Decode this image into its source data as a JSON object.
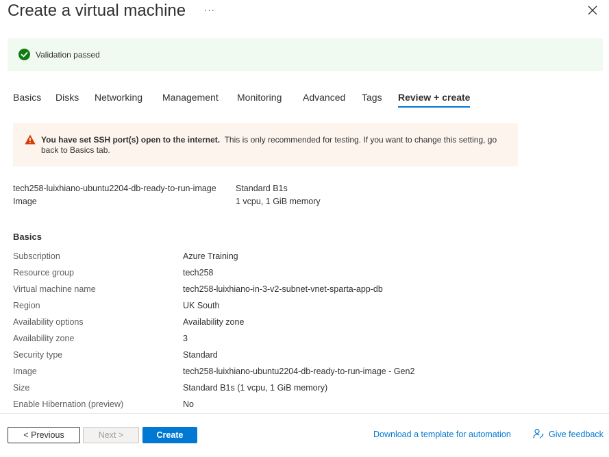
{
  "header": {
    "title": "Create a virtual machine",
    "more": "···"
  },
  "validation": {
    "text": "Validation passed",
    "color": "#107c10"
  },
  "tabs": [
    {
      "label": "Basics"
    },
    {
      "label": "Disks"
    },
    {
      "label": "Networking"
    },
    {
      "label": "Management"
    },
    {
      "label": "Monitoring"
    },
    {
      "label": "Advanced"
    },
    {
      "label": "Tags"
    },
    {
      "label": "Review + create",
      "active": true
    }
  ],
  "warning": {
    "bold": "You have set SSH port(s) open to the internet.",
    "text": "This is only recommended for testing.  If you want to change this setting, go back to Basics tab.",
    "color": "#d83b01"
  },
  "summary": {
    "image_name": "tech258-luixhiano-ubuntu2204-db-ready-to-run-image",
    "image_label": "Image",
    "size_name": "Standard B1s",
    "size_detail": "1 vcpu, 1 GiB memory"
  },
  "basics": {
    "title": "Basics",
    "rows": [
      {
        "key": "Subscription",
        "value": "Azure Training"
      },
      {
        "key": "Resource group",
        "value": "tech258"
      },
      {
        "key": "Virtual machine name",
        "value": "tech258-luixhiano-in-3-v2-subnet-vnet-sparta-app-db"
      },
      {
        "key": "Region",
        "value": "UK South"
      },
      {
        "key": "Availability options",
        "value": "Availability zone"
      },
      {
        "key": "Availability zone",
        "value": "3"
      },
      {
        "key": "Security type",
        "value": "Standard"
      },
      {
        "key": "Image",
        "value": "tech258-luixhiano-ubuntu2204-db-ready-to-run-image - Gen2"
      },
      {
        "key": "Size",
        "value": "Standard B1s (1 vcpu, 1 GiB memory)"
      },
      {
        "key": "Enable Hibernation (preview)",
        "value": "No"
      }
    ]
  },
  "footer": {
    "previous": "< Previous",
    "next": "Next >",
    "create": "Create",
    "download": "Download a template for automation",
    "feedback": "Give feedback"
  },
  "colors": {
    "accent": "#0078d4"
  }
}
